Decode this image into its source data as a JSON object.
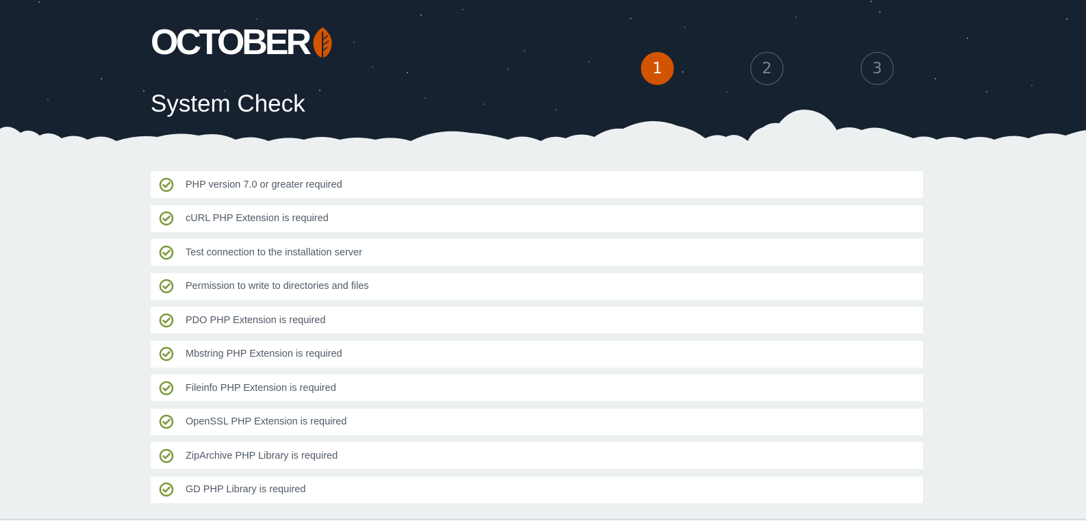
{
  "header": {
    "logo_text": "OCTOBER",
    "page_title": "System Check"
  },
  "steps": [
    {
      "label": "1",
      "active": true
    },
    {
      "label": "2",
      "active": false
    },
    {
      "label": "3",
      "active": false
    }
  ],
  "checks": [
    {
      "label": "PHP version 7.0 or greater required",
      "status": "pass"
    },
    {
      "label": "cURL PHP Extension is required",
      "status": "pass"
    },
    {
      "label": "Test connection to the installation server",
      "status": "pass"
    },
    {
      "label": "Permission to write to directories and files",
      "status": "pass"
    },
    {
      "label": "PDO PHP Extension is required",
      "status": "pass"
    },
    {
      "label": "Mbstring PHP Extension is required",
      "status": "pass"
    },
    {
      "label": "Fileinfo PHP Extension is required",
      "status": "pass"
    },
    {
      "label": "OpenSSL PHP Extension is required",
      "status": "pass"
    },
    {
      "label": "ZipArchive PHP Library is required",
      "status": "pass"
    },
    {
      "label": "GD PHP Library is required",
      "status": "pass"
    }
  ],
  "colors": {
    "header_bg": "#172230",
    "accent": "#d35400",
    "check_green": "#7a9a3a",
    "page_bg": "#ecf0f1"
  },
  "icons": {
    "check": "check-circle-icon",
    "logo_leaf": "leaf-icon"
  }
}
